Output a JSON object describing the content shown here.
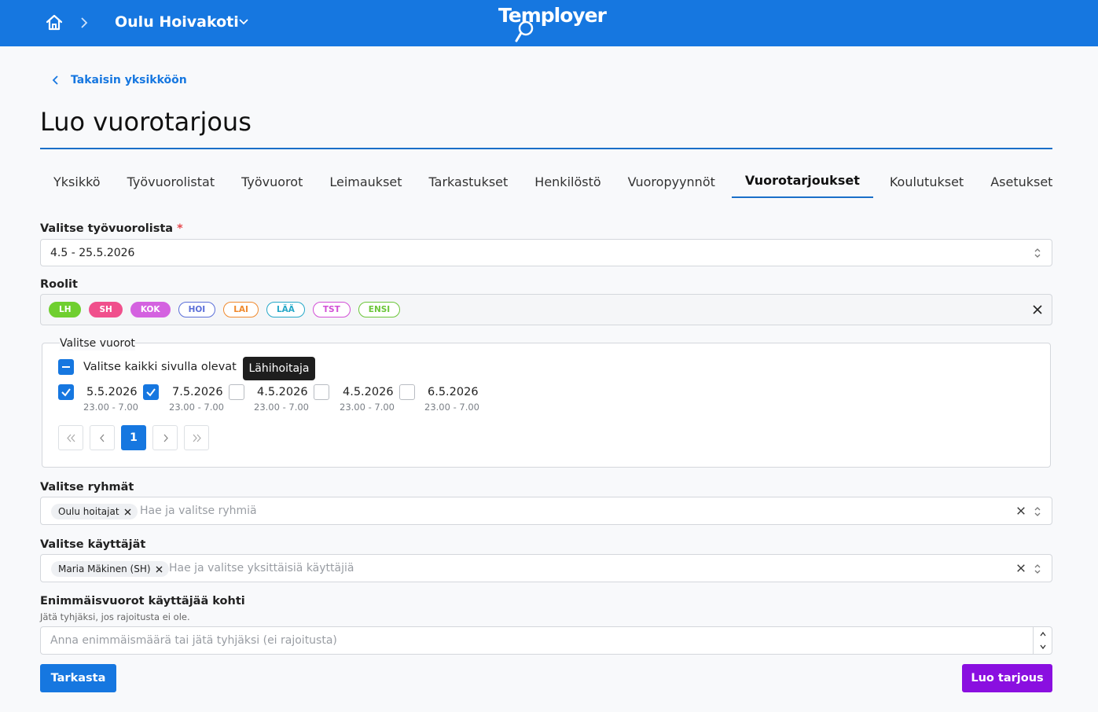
{
  "topbar": {
    "unit_name": "Oulu Hoivakoti",
    "logo_text": "Temployer",
    "bg_color": "#1677e0"
  },
  "back_link": "Takaisin yksikköön",
  "page_title": "Luo vuorotarjous",
  "tabs": [
    "Yksikkö",
    "Työvuorolistat",
    "Työvuorot",
    "Leimaukset",
    "Tarkastukset",
    "Henkilöstö",
    "Vuoropyynnöt",
    "Vuorotarjoukset",
    "Koulutukset",
    "Asetukset"
  ],
  "active_tab": "Vuorotarjoukset",
  "shiftlist": {
    "label": "Valitse työvuorolista",
    "required_mark": "*",
    "value": "4.5 - 25.5.2026"
  },
  "roles": {
    "label": "Roolit",
    "chips": [
      {
        "label": "LH",
        "style": "filled",
        "color": "#6fcf2f"
      },
      {
        "label": "SH",
        "style": "filled",
        "color": "#f0508c"
      },
      {
        "label": "KOK",
        "style": "filled",
        "color": "#d462e0"
      },
      {
        "label": "HOI",
        "style": "outline",
        "color": "#5b6fd8"
      },
      {
        "label": "LAI",
        "style": "outline",
        "color": "#f08a2e"
      },
      {
        "label": "LÄÄ",
        "style": "outline",
        "color": "#26a8c8"
      },
      {
        "label": "TST",
        "style": "outline",
        "color": "#d24fd6"
      },
      {
        "label": "ENSI",
        "style": "outline",
        "color": "#6cc63a"
      }
    ]
  },
  "shifts_panel": {
    "legend": "Valitse vuorot",
    "select_all_label": "Valitse kaikki sivulla olevat",
    "tooltip": "Lähihoitaja",
    "shifts": [
      {
        "date": "5.5.2026",
        "time": "23.00 - 7.00",
        "checked": true
      },
      {
        "date": "7.5.2026",
        "time": "23.00 - 7.00",
        "checked": true
      },
      {
        "date": "4.5.2026",
        "time": "23.00 - 7.00",
        "checked": false
      },
      {
        "date": "4.5.2026",
        "time": "23.00 - 7.00",
        "checked": false
      },
      {
        "date": "6.5.2026",
        "time": "23.00 - 7.00",
        "checked": false
      }
    ],
    "current_page": "1"
  },
  "groups": {
    "label": "Valitse ryhmät",
    "tag": "Oulu hoitajat",
    "placeholder": "Hae ja valitse ryhmiä"
  },
  "users": {
    "label": "Valitse käyttäjät",
    "tag": "Maria Mäkinen (SH)",
    "placeholder": "Hae ja valitse yksittäisiä käyttäjiä"
  },
  "max_shifts": {
    "label": "Enimmäisvuorot käyttäjää kohti",
    "hint": "Jätä tyhjäksi, jos rajoitusta ei ole.",
    "placeholder": "Anna enimmäismäärä tai jätä tyhjäksi (ei rajoitusta)"
  },
  "buttons": {
    "check": "Tarkasta",
    "check_color": "#1677e0",
    "create": "Luo tarjous",
    "create_color": "#8a0fe0"
  }
}
